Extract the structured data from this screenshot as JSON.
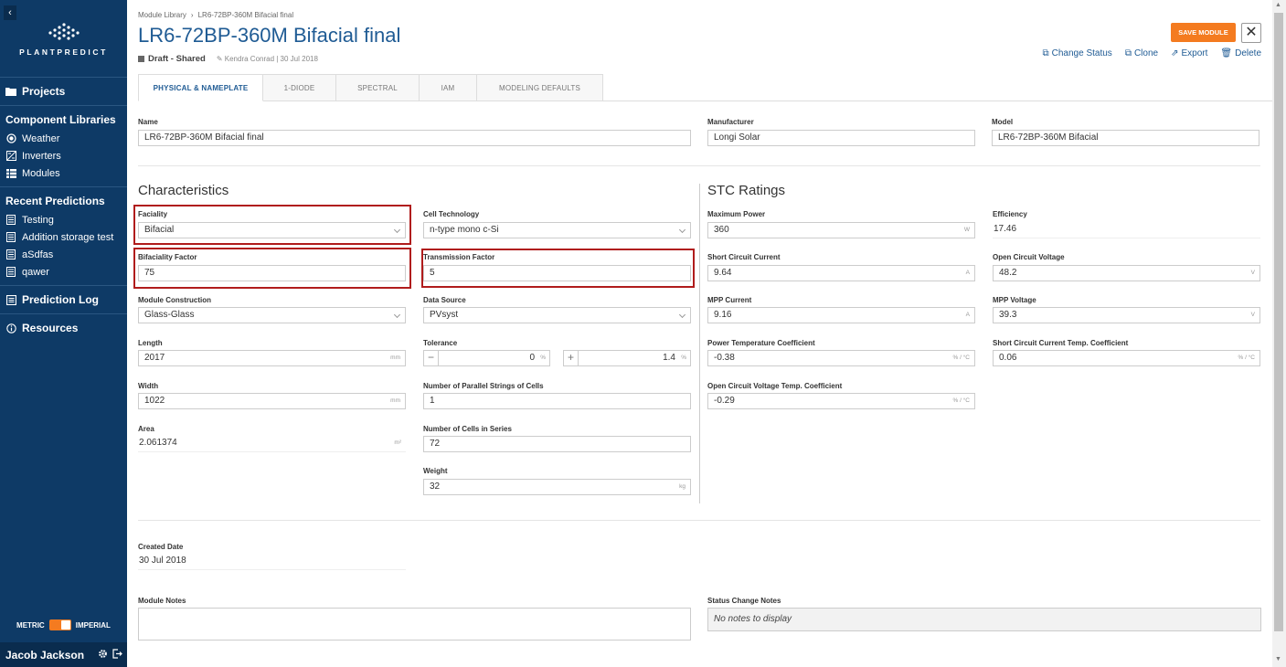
{
  "sidebar": {
    "collapse_glyph": "‹",
    "logo_text": "PLANTPREDICT",
    "projects": "Projects",
    "component_libraries": "Component Libraries",
    "libraries": [
      {
        "label": "Weather",
        "icon": "weather-icon"
      },
      {
        "label": "Inverters",
        "icon": "inverter-icon"
      },
      {
        "label": "Modules",
        "icon": "modules-icon"
      }
    ],
    "recent_predictions_title": "Recent Predictions",
    "recent": [
      "Testing",
      "Addition storage test",
      "aSdfas",
      "qawer"
    ],
    "prediction_log": "Prediction Log",
    "resources": "Resources",
    "unit_left": "METRIC",
    "unit_right": "IMPERIAL",
    "user_name": "Jacob Jackson"
  },
  "header": {
    "breadcrumb_root": "Module Library",
    "breadcrumb_current": "LR6-72BP-360M Bifacial final",
    "title": "LR6-72BP-360M Bifacial final",
    "status": "Draft - Shared",
    "author": "Kendra Conrad | 30 Jul 2018",
    "save_label": "SAVE MODULE",
    "close_glyph": "✕",
    "actions": [
      "Change Status",
      "Clone",
      "Export",
      "Delete"
    ]
  },
  "tabs": [
    "PHYSICAL & NAMEPLATE",
    "1-DIODE",
    "SPECTRAL",
    "IAM",
    "MODELING DEFAULTS"
  ],
  "general": {
    "name_label": "Name",
    "name_value": "LR6-72BP-360M Bifacial final",
    "manufacturer_label": "Manufacturer",
    "manufacturer_value": "Longi Solar",
    "model_label": "Model",
    "model_value": "LR6-72BP-360M Bifacial"
  },
  "characteristics": {
    "heading": "Characteristics",
    "faciality_label": "Faciality",
    "faciality_value": "Bifacial",
    "cell_tech_label": "Cell Technology",
    "cell_tech_value": "n-type mono c-Si",
    "bifaciality_label": "Bifaciality Factor",
    "bifaciality_value": "75",
    "transmission_label": "Transmission Factor",
    "transmission_value": "5",
    "construction_label": "Module Construction",
    "construction_value": "Glass-Glass",
    "data_source_label": "Data Source",
    "data_source_value": "PVsyst",
    "length_label": "Length",
    "length_value": "2017",
    "length_unit": "mm",
    "tolerance_label": "Tolerance",
    "tol_minus_glyph": "−",
    "tol_minus_value": "0",
    "tol_plus_glyph": "+",
    "tol_plus_value": "1.4",
    "tol_unit": "%",
    "width_label": "Width",
    "width_value": "1022",
    "width_unit": "mm",
    "parallel_label": "Number of Parallel Strings of Cells",
    "parallel_value": "1",
    "area_label": "Area",
    "area_value": "2.061374",
    "area_unit": "m²",
    "cells_series_label": "Number of Cells in Series",
    "cells_series_value": "72",
    "weight_label": "Weight",
    "weight_value": "32",
    "weight_unit": "kg"
  },
  "stc": {
    "heading": "STC Ratings",
    "max_power_label": "Maximum Power",
    "max_power_value": "360",
    "max_power_unit": "W",
    "efficiency_label": "Efficiency",
    "efficiency_value": "17.46",
    "isc_label": "Short Circuit Current",
    "isc_value": "9.64",
    "isc_unit": "A",
    "voc_label": "Open Circuit Voltage",
    "voc_value": "48.2",
    "voc_unit": "V",
    "impp_label": "MPP Current",
    "impp_value": "9.16",
    "impp_unit": "A",
    "vmpp_label": "MPP Voltage",
    "vmpp_value": "39.3",
    "vmpp_unit": "V",
    "ptc_label": "Power Temperature Coefficient",
    "ptc_value": "-0.38",
    "ptc_unit": "% / °C",
    "isctc_label": "Short Circuit Current Temp. Coefficient",
    "isctc_value": "0.06",
    "isctc_unit": "% / °C",
    "voctc_label": "Open Circuit Voltage Temp. Coefficient",
    "voctc_value": "-0.29",
    "voctc_unit": "% / °C"
  },
  "footer": {
    "created_label": "Created Date",
    "created_value": "30 Jul 2018",
    "notes_label": "Module Notes",
    "status_notes_label": "Status Change Notes",
    "status_notes_value": "No notes to display"
  },
  "colors": {
    "accent": "#f47b20",
    "sidebar": "#0e3a66",
    "title": "#1f5b94",
    "highlight": "#b01c1c"
  }
}
